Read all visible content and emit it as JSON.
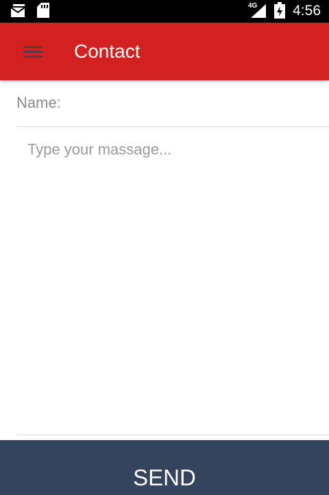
{
  "status_bar": {
    "time": "4:56",
    "network_type": "4G",
    "icons": [
      "mail-icon",
      "sd-card-icon",
      "signal-icon",
      "battery-charging-icon"
    ]
  },
  "app_bar": {
    "title": "Contact",
    "menu_icon": "hamburger-menu-icon",
    "color": "#d32020"
  },
  "form": {
    "name_label": "Name:",
    "name_value": "",
    "message_value": "",
    "message_placeholder": "Type your massage..."
  },
  "send_button": {
    "label": "SEND",
    "color": "#34445c"
  }
}
